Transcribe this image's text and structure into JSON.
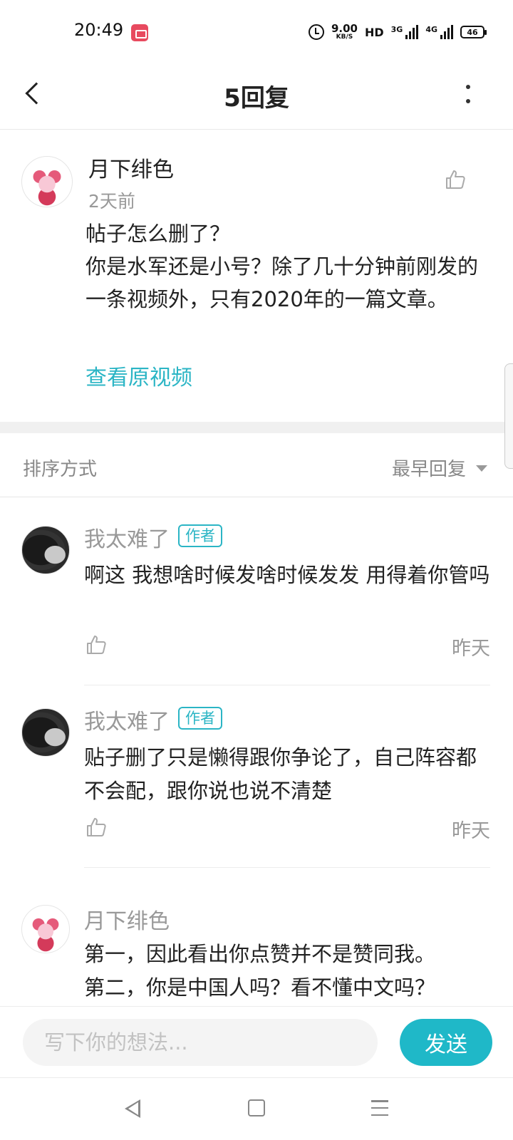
{
  "status_bar": {
    "time": "20:49",
    "net_speed_value": "9.00",
    "net_speed_unit": "KB/S",
    "hd_label": "HD",
    "sim1_label": "3G",
    "sim2_label": "4G",
    "battery": "46"
  },
  "header": {
    "title": "5回复"
  },
  "main_comment": {
    "author": "月下绯色",
    "time": "2天前",
    "text": "帖子怎么删了？\n你是水军还是小号？除了几十分钟前刚发的一条视频外，只有2020年的一篇文章。",
    "view_original_link": "查看原视频"
  },
  "sort": {
    "label": "排序方式",
    "value": "最早回复"
  },
  "replies": [
    {
      "author": "我太难了",
      "badge": "作者",
      "text": "啊这 我想啥时候发啥时候发发 用得着你管吗",
      "time": "昨天"
    },
    {
      "author": "我太难了",
      "badge": "作者",
      "text": "贴子删了只是懒得跟你争论了，自己阵容都不会配，跟你说也说不清楚",
      "time": "昨天"
    },
    {
      "author": "月下绯色",
      "text": "第一，因此看出你点赞并不是赞同我。\n第二，你是中国人吗？看不懂中文吗？"
    }
  ],
  "input": {
    "placeholder": "写下你的想法...",
    "send_label": "发送"
  },
  "colors": {
    "accent": "#1fb8c8",
    "link": "#2bb5c5",
    "muted_text": "#999999"
  }
}
